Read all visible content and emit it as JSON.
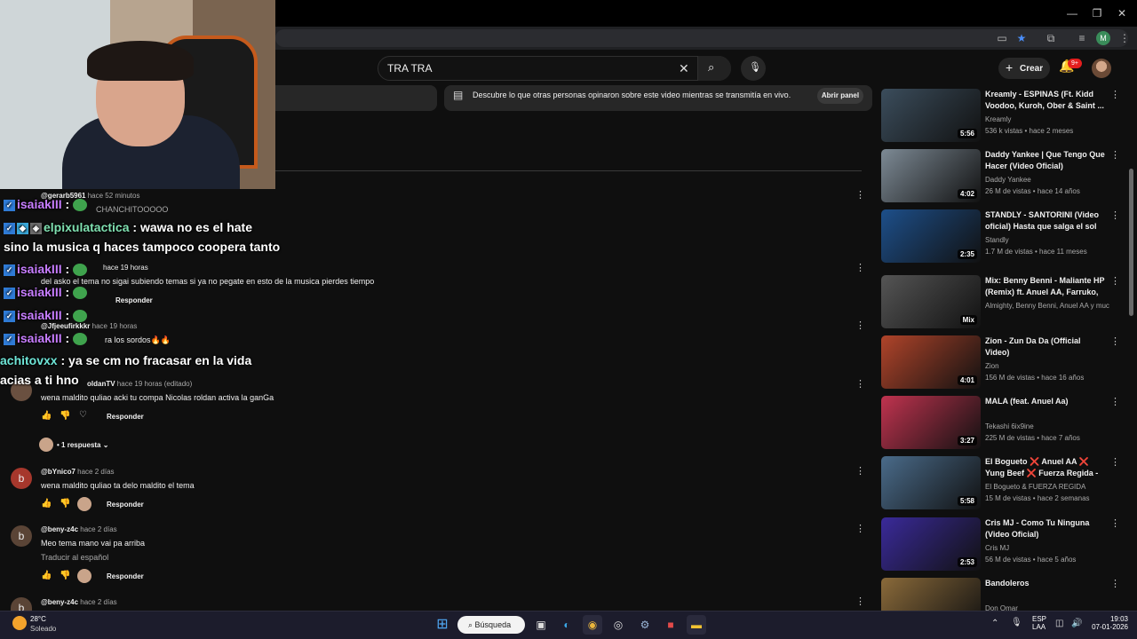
{
  "youtube": {
    "search": {
      "query": "TRA TRA"
    },
    "create_label": "Crear",
    "notif_badge": "9+",
    "live_chat": {
      "text": "Descubre lo que otras personas opinaron sobre este video mientras se transmitía en vivo.",
      "button": "Abrir panel"
    },
    "comments": [
      {
        "user": "@gerarb5961",
        "time": "hace 52 minutos",
        "text": "CHANCHITOOOOO"
      },
      {
        "user": "@ ",
        "time": "hace 19 horas",
        "text": "del asko el tema no sigai subiendo temas si ya no pegate en esto de la musica pierdes tiempo",
        "reply": "Responder"
      },
      {
        "user": "@Jfjeeufirkkkr",
        "time": "hace 19 horas",
        "text": "ra los sordos🔥🔥"
      },
      {
        "user": "oldanTV",
        "time": "hace 19 horas (editado)",
        "text": "wena maldito quliao acki tu compa Nicolas roldan activa la ganGa",
        "reply": "Responder",
        "replies": "1 respuesta"
      },
      {
        "user": "@bYnico7",
        "time": "hace 2 días",
        "text": "wena maldito quliao ta delo maldito el tema",
        "reply": "Responder",
        "avatar": "b"
      },
      {
        "user": "@beny-z4c",
        "time": "hace 2 días",
        "text": "Meo tema mano vai pa arriba",
        "translate": "Traducir al español",
        "reply": "Responder",
        "avatar": "b"
      },
      {
        "user": "@beny-z4c",
        "time": "hace 2 días",
        "avatar": "b"
      }
    ],
    "related": [
      {
        "title": "Kreamly - ESPINAS (Ft. Kidd Voodoo, Kuroh, Ober & Saint ...",
        "channel": "Kreamly",
        "meta": "536 k vistas • hace 2 meses",
        "duration": "5:56",
        "color": "#3b4d5c"
      },
      {
        "title": "Daddy Yankee | Que Tengo Que Hacer (Video Oficial)",
        "channel": "Daddy Yankee",
        "meta": "26 M de vistas • hace 14 años",
        "duration": "4:02",
        "color": "#7d8a95"
      },
      {
        "title": "STANDLY - SANTORINI (Video oficial) Hasta que salga el sol ...",
        "channel": "Standly",
        "meta": "1.7 M de vistas • hace 11 meses",
        "duration": "2:35",
        "color": "#1d4f8a"
      },
      {
        "title": "Mix: Benny Benni - Maliante HP (Remix) ft. Anuel AA, Farruko, ...",
        "channel": "Almighty, Benny Benni, Anuel AA y much...",
        "meta": "",
        "duration": "Mix",
        "color": "#555"
      },
      {
        "title": "Zion - Zun Da Da (Official Video)",
        "channel": "Zion",
        "meta": "156 M de vistas • hace 16 años",
        "duration": "4:01",
        "color": "#b0442a"
      },
      {
        "title": "MALA (feat. Anuel Aa)",
        "channel": "Tekashi 6ix9ine",
        "meta": "225 M de vistas • hace 7 años",
        "duration": "3:27",
        "color": "#c0334f"
      },
      {
        "title": "El Bogueto ❌ Anuel AA ❌ Yung Beef ❌ Fuerza Regida - ...",
        "channel": "El Bogueto & FUERZA REGIDA",
        "meta": "15 M de vistas • hace 2 semanas",
        "duration": "5:58",
        "color": "#4a6b8a"
      },
      {
        "title": "Cris MJ - Como Tu Ninguna (Video Oficial)",
        "channel": "Cris MJ",
        "meta": "56 M de vistas • hace 5 años",
        "duration": "2:53",
        "color": "#3a2a9a"
      },
      {
        "title": "Bandoleros",
        "channel": "Don Omar",
        "meta": "",
        "duration": "",
        "color": "#8a6a3a"
      }
    ]
  },
  "overlay_chat": [
    {
      "user": "isaiakIII",
      "msg": "",
      "color": "u1"
    },
    {
      "user": "elpixulatactica",
      "msg": ": wawa no es el hate",
      "color": "u2"
    },
    {
      "user": "",
      "msg": "sino la musica q haces tampoco coopera tanto",
      "color": ""
    },
    {
      "user": "isaiakIII",
      "msg": "",
      "color": "u1"
    },
    {
      "user": "isaiakIII",
      "msg": "",
      "color": "u1"
    },
    {
      "user": "isaiakIII",
      "msg": "",
      "color": "u1"
    },
    {
      "user": "isaiakIII",
      "msg": "",
      "color": "u1"
    },
    {
      "user": "achitovxx",
      "msg": ": ya se cm no fracasar en la vida",
      "color": "u3"
    },
    {
      "user": "",
      "msg": "acias a ti hno",
      "color": ""
    }
  ],
  "taskbar": {
    "weather_temp": "28°C",
    "weather_desc": "Soleado",
    "search": "Búsqueda",
    "lang1": "ESP",
    "lang2": "LAA",
    "time": "19:03",
    "date": "07-01-2026"
  }
}
